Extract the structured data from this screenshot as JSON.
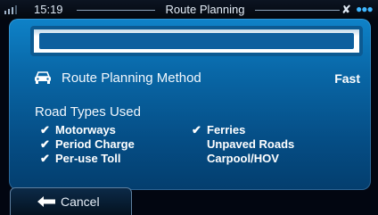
{
  "status_bar": {
    "time": "15:19",
    "title": "Route Planning",
    "accent_color": "#3fb7ff"
  },
  "search_field": {
    "value": ""
  },
  "route_planning_method": {
    "label": "Route Planning Method",
    "value": "Fast",
    "icon": "car-icon"
  },
  "road_types": {
    "title": "Road Types Used",
    "left_column": [
      {
        "label": "Motorways",
        "checked": true
      },
      {
        "label": "Period Charge",
        "checked": true
      },
      {
        "label": "Per-use Toll",
        "checked": true
      }
    ],
    "right_column": [
      {
        "label": "Ferries",
        "checked": true
      },
      {
        "label": "Unpaved Roads",
        "checked": false
      },
      {
        "label": "Carpool/HOV",
        "checked": false
      }
    ],
    "check_glyph": "✔"
  },
  "cancel_button": {
    "label": "Cancel",
    "icon": "arrow-left-icon"
  }
}
